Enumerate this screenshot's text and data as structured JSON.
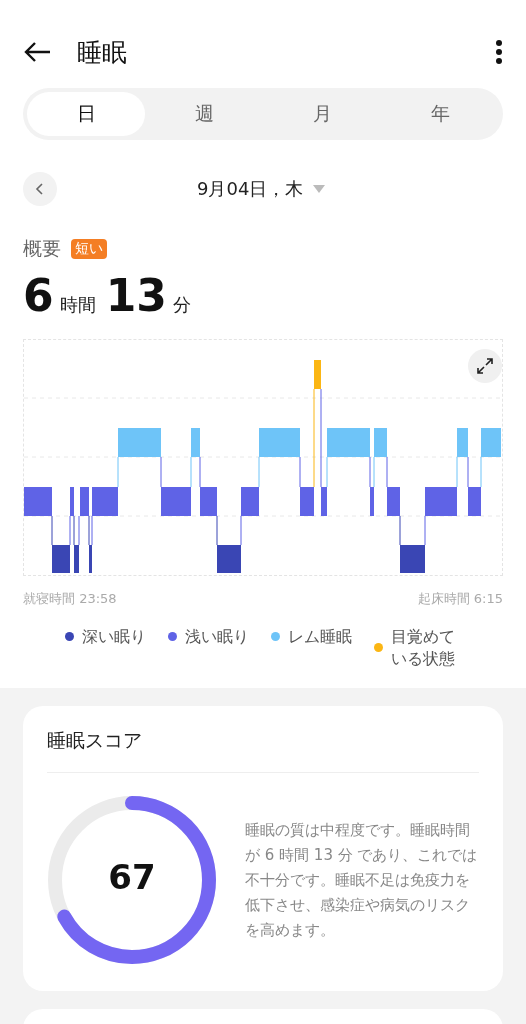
{
  "header": {
    "title": "睡眠"
  },
  "tabs": [
    {
      "label": "日",
      "selected": true
    },
    {
      "label": "週",
      "selected": false
    },
    {
      "label": "月",
      "selected": false
    },
    {
      "label": "年",
      "selected": false
    }
  ],
  "date": {
    "label": "9月04日，木"
  },
  "summary": {
    "label": "概要",
    "badge": "短い",
    "hours": "6",
    "hours_unit": "時間",
    "minutes": "13",
    "minutes_unit": "分"
  },
  "chart": {
    "bedtime": "就寝時間 23:58",
    "wake_time": "起床時間 6:15"
  },
  "legend": [
    {
      "label": "深い眠り",
      "color": "#3a46b4"
    },
    {
      "label": "浅い眠り",
      "color": "#5f63e6"
    },
    {
      "label": "レム睡眠",
      "color": "#6ec4f8"
    },
    {
      "label": "目覚めている状態",
      "color": "#fbb614"
    }
  ],
  "score_card": {
    "title": "睡眠スコア",
    "score": "67",
    "description": "睡眠の質は中程度です。睡眠時間が 6 時間 13 分 であり、これでは不十分です。睡眠不足は免疫力を低下させ、感染症や病気のリスクを高めます。"
  }
}
